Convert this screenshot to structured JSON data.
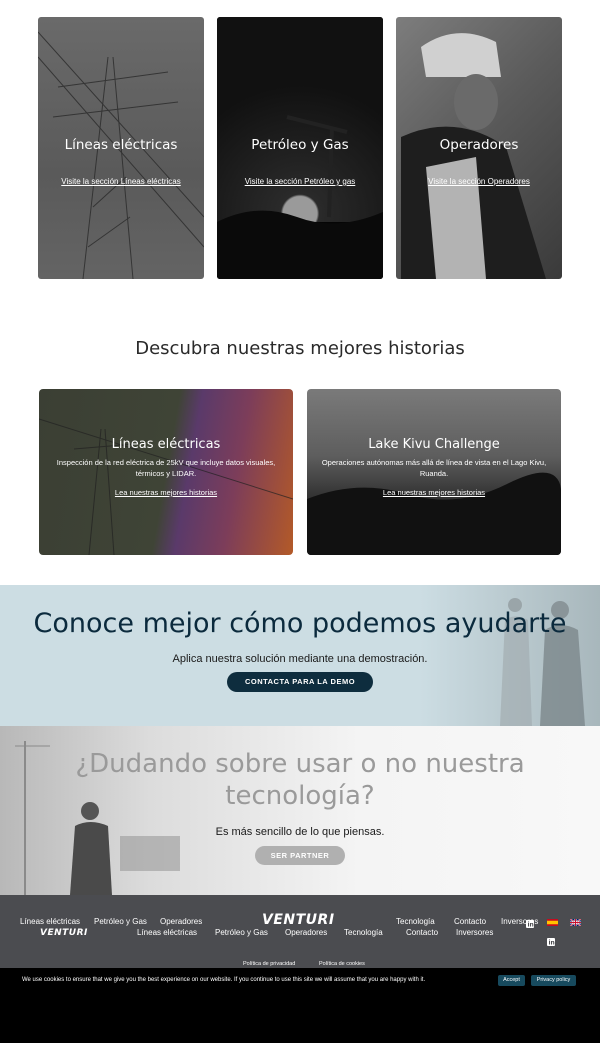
{
  "sector_cards": [
    {
      "title": "Líneas eléctricas",
      "link": "Visite la sección Líneas eléctricas"
    },
    {
      "title": "Petróleo y Gas",
      "link": "Visite la sección Petróleo y gas"
    },
    {
      "title": "Operadores",
      "link": "Visite la sección Operadores"
    }
  ],
  "stories": {
    "title": "Descubra nuestras mejores historias",
    "items": [
      {
        "title": "Líneas eléctricas",
        "desc": "Inspección de la red eléctrica de 25kV que incluye datos visuales, térmicos y LIDAR.",
        "link": "Lea nuestras mejores historias"
      },
      {
        "title": "Lake Kivu Challenge",
        "desc": "Operaciones autónomas más allá de línea de vista en el Lago Kivu, Ruanda.",
        "link": "Lea nuestras mejores historias"
      }
    ]
  },
  "help": {
    "title": "Conoce mejor cómo podemos ayudarte",
    "subtitle": "Aplica nuestra solución mediante una demostración.",
    "button": "Contacta para la demo"
  },
  "doubt": {
    "title": "¿Dudando sobre usar o no nuestra tecnología?",
    "subtitle": "Es más sencillo de lo que piensas.",
    "button": "Ser partner"
  },
  "footer": {
    "logo": "VENTURI",
    "left_links": [
      "Líneas eléctricas",
      "Petróleo y Gas",
      "Operadores"
    ],
    "right_links": [
      "Tecnología",
      "Contacto",
      "Inversores"
    ],
    "center_links": [
      "Líneas eléctricas",
      "Petróleo y Gas",
      "Operadores",
      "Tecnología",
      "Contacto",
      "Inversores"
    ],
    "legal": [
      "Política de privacidad",
      "Política de cookies"
    ]
  },
  "cookie": {
    "message": "We use cookies to ensure that we give you the best experience on our website. If you continue to use this site we will assume that you are happy with it.",
    "accept": "Accept",
    "policy": "Privacy policy"
  },
  "colors": {
    "brand_dark": "#0e2d3e",
    "help_bg": "#ccdde3",
    "footer_bg": "#4b4c50",
    "cookie_btn": "#174a5e"
  },
  "icons": [
    "linkedin-icon",
    "spain-flag-icon",
    "uk-flag-icon"
  ]
}
